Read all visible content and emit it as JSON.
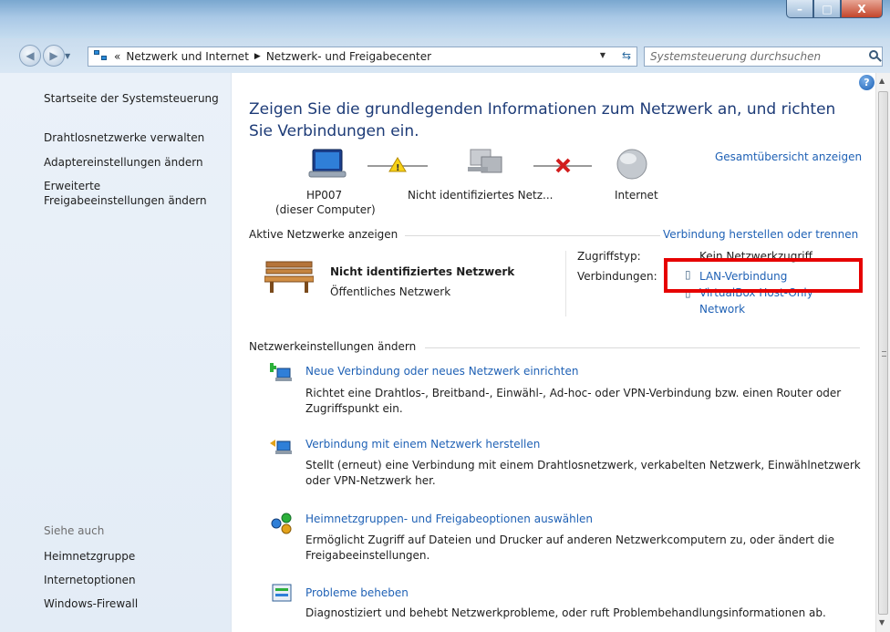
{
  "window": {
    "minimize": "–",
    "maximize": "□",
    "close": "X"
  },
  "address": {
    "prefix": "«",
    "segment1": "Netzwerk und Internet",
    "separator": "▶",
    "segment2": "Netzwerk- und Freigabecenter"
  },
  "search": {
    "placeholder": "Systemsteuerung durchsuchen"
  },
  "sidebar": {
    "home": "Startseite der Systemsteuerung",
    "items": [
      "Drahtlosnetzwerke verwalten",
      "Adaptereinstellungen ändern",
      "Erweiterte",
      "Freigabeeinstellungen ändern"
    ],
    "see_also_label": "Siehe auch",
    "see_also": [
      "Heimnetzgruppe",
      "Internetoptionen",
      "Windows-Firewall"
    ]
  },
  "main": {
    "headline": "Zeigen Sie die grundlegenden Informationen zum Netzwerk an, und richten Sie Verbindungen ein.",
    "overview_link": "Gesamtübersicht anzeigen",
    "map": {
      "computer_name": "HP007",
      "computer_sub": "(dieser Computer)",
      "network_name": "Nicht identifiziertes Netz...",
      "internet": "Internet"
    },
    "active_header": "Aktive Netzwerke anzeigen",
    "connect_link": "Verbindung herstellen oder trennen",
    "active_network": {
      "name": "Nicht identifiziertes Netzwerk",
      "type": "Öffentliches Netzwerk",
      "access_label": "Zugriffstyp:",
      "access_value": "Kein Netzwerkzugriff",
      "connections_label": "Verbindungen:",
      "connection1": "LAN-Verbindung",
      "connection2_line1": "VirtualBox Host-Only",
      "connection2_line2": "Network"
    },
    "settings_header": "Netzwerkeinstellungen ändern",
    "actions": [
      {
        "title": "Neue Verbindung oder neues Netzwerk einrichten",
        "desc1": "Richtet eine Drahtlos-, Breitband-, Einwähl-, Ad-hoc- oder VPN-Verbindung bzw. einen Router oder",
        "desc2": "Zugriffspunkt ein."
      },
      {
        "title": "Verbindung mit einem Netzwerk herstellen",
        "desc1": "Stellt (erneut) eine Verbindung mit einem Drahtlosnetzwerk, verkabelten Netzwerk, Einwählnetzwerk",
        "desc2": "oder VPN-Netzwerk her."
      },
      {
        "title": "Heimnetzgruppen- und Freigabeoptionen auswählen",
        "desc1": "Ermöglicht Zugriff auf Dateien und Drucker auf anderen Netzwerkcomputern zu, oder ändert die",
        "desc2": "Freigabeeinstellungen."
      },
      {
        "title": "Probleme beheben",
        "desc1": "Diagnostiziert und behebt Netzwerkprobleme, oder ruft Problembehandlungsinformationen ab.",
        "desc2": ""
      }
    ]
  },
  "colors": {
    "link": "#1f61b5",
    "headline": "#1d3b77",
    "highlight": "#e60000",
    "sidebar_bg": "#e3ecf6"
  }
}
